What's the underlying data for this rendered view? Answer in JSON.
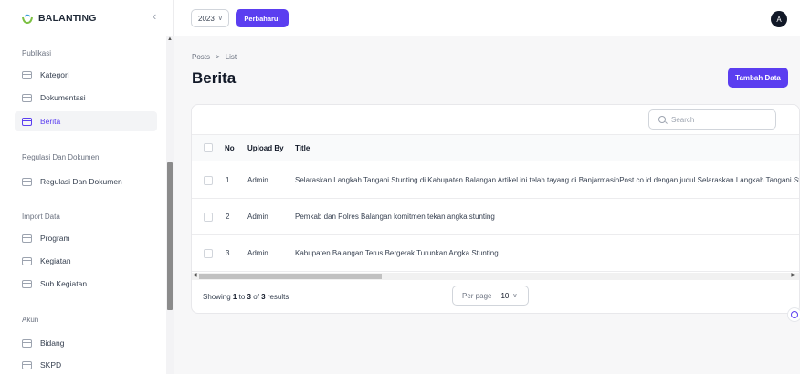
{
  "brand": {
    "name": "BALANTING"
  },
  "topbar": {
    "year": "2023",
    "refresh_label": "Perbaharui",
    "avatar_initial": "A"
  },
  "sidebar": {
    "groups": [
      {
        "label": "Publikasi",
        "items": [
          {
            "label": "Kategori"
          },
          {
            "label": "Dokumentasi"
          },
          {
            "label": "Berita",
            "active": true
          }
        ]
      },
      {
        "label": "Regulasi Dan Dokumen",
        "items": [
          {
            "label": "Regulasi Dan Dokumen"
          }
        ]
      },
      {
        "label": "Import Data",
        "items": [
          {
            "label": "Program"
          },
          {
            "label": "Kegiatan"
          },
          {
            "label": "Sub Kegiatan"
          }
        ]
      },
      {
        "label": "Akun",
        "items": [
          {
            "label": "Bidang"
          },
          {
            "label": "SKPD"
          }
        ]
      }
    ]
  },
  "breadcrumb": {
    "parent": "Posts",
    "separator": ">",
    "current": "List"
  },
  "page": {
    "title": "Berita",
    "add_label": "Tambah Data"
  },
  "table": {
    "search_placeholder": "Search",
    "columns": {
      "no": "No",
      "upload_by": "Upload By",
      "title": "Title"
    },
    "rows": [
      {
        "no": "1",
        "upload_by": "Admin",
        "title": "Selaraskan Langkah Tangani Stunting di Kabupaten Balangan Artikel ini telah tayang di BanjarmasinPost.co.id dengan judul Selaraskan Langkah Tangani Stunting di Kabupaten Balangan"
      },
      {
        "no": "2",
        "upload_by": "Admin",
        "title": "Pemkab dan Polres Balangan komitmen tekan angka stunting"
      },
      {
        "no": "3",
        "upload_by": "Admin",
        "title": "Kabupaten Balangan Terus Bergerak Turunkan Angka Stunting"
      }
    ],
    "footer": {
      "prefix": "Showing",
      "from": "1",
      "to_word": "to",
      "to": "3",
      "of_word": "of",
      "total": "3",
      "suffix": "results"
    },
    "per_page_label": "Per page",
    "per_page_value": "10"
  },
  "colors": {
    "accent": "#5b3ef0"
  }
}
